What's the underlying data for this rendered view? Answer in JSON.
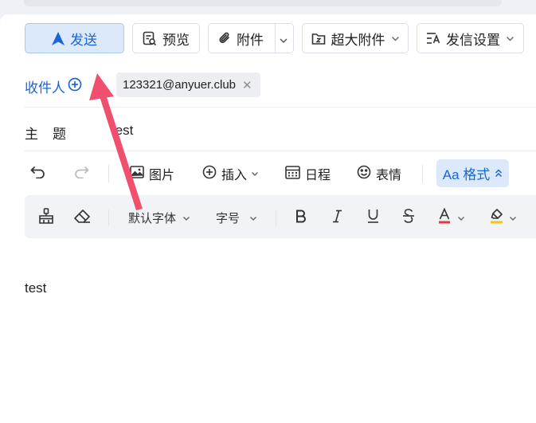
{
  "toolbar": {
    "send_label": "发送",
    "preview_label": "预览",
    "attach_label": "附件",
    "big_attach_label": "超大附件",
    "send_settings_label": "发信设置"
  },
  "recipient": {
    "label": "收件人",
    "chips": [
      "123321@anyuer.club"
    ]
  },
  "subject": {
    "label": "主题",
    "value": "test"
  },
  "editor_toolbar": {
    "image_label": "图片",
    "insert_label": "插入",
    "calendar_label": "日程",
    "emoji_label": "表情",
    "format_label": "Aa 格式"
  },
  "format_bar": {
    "font_family": "默认字体",
    "font_size": "字号"
  },
  "body": {
    "text": "test"
  },
  "colors": {
    "accent": "#1a66d9",
    "arrow": "#f0506e",
    "font_color_bar": "#e03a3a",
    "highlight_bar": "#f5c518"
  }
}
